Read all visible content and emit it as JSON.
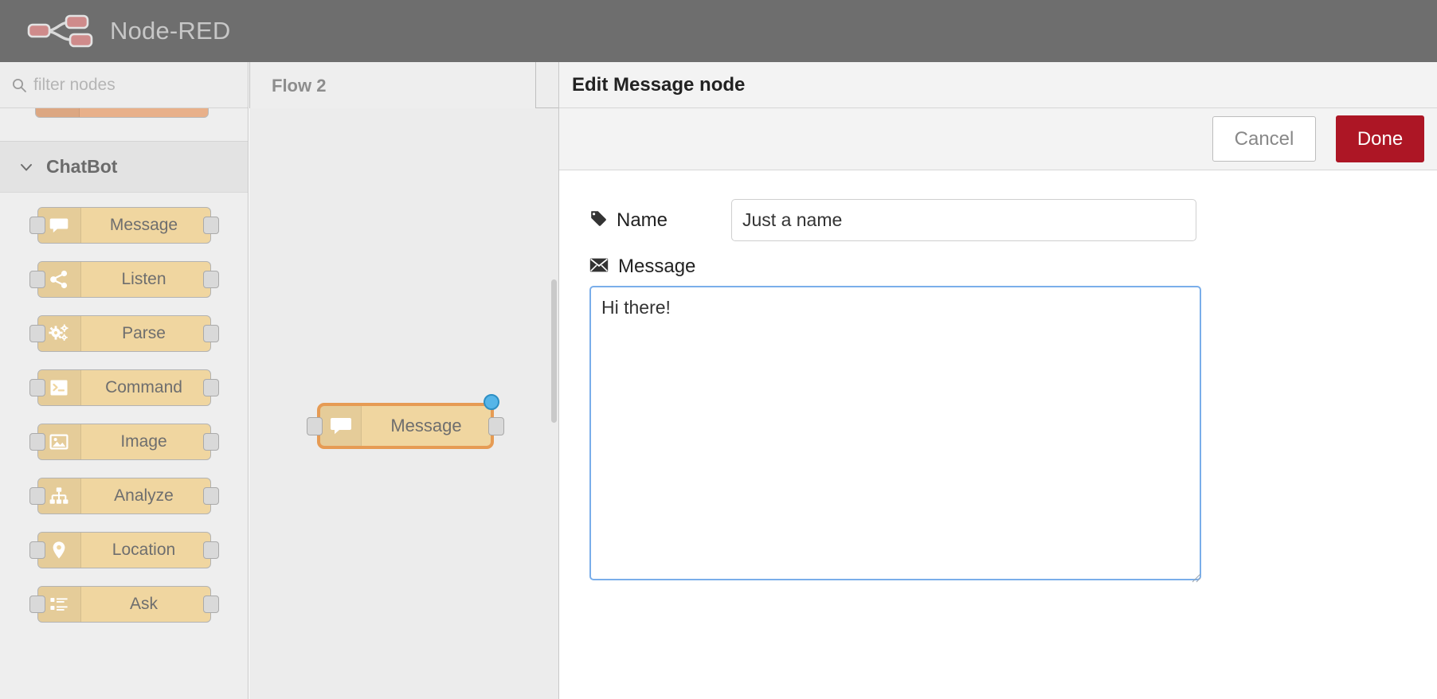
{
  "header": {
    "title": "Node-RED",
    "logo_icon": "node-red-logo-icon"
  },
  "palette": {
    "search": {
      "placeholder": "filter nodes",
      "value": "",
      "icon": "search-icon"
    },
    "category": {
      "label": "ChatBot",
      "chevron_icon": "chevron-down-icon",
      "expanded": true
    },
    "nodes": [
      {
        "label": "Message",
        "icon": "comment-icon"
      },
      {
        "label": "Listen",
        "icon": "share-nodes-icon"
      },
      {
        "label": "Parse",
        "icon": "cogs-icon"
      },
      {
        "label": "Command",
        "icon": "terminal-icon"
      },
      {
        "label": "Image",
        "icon": "image-icon"
      },
      {
        "label": "Analyze",
        "icon": "sitemap-icon"
      },
      {
        "label": "Location",
        "icon": "map-pin-icon"
      },
      {
        "label": "Ask",
        "icon": "list-icon"
      }
    ]
  },
  "workspace": {
    "tab": {
      "label": "Flow 2",
      "active": true
    },
    "node": {
      "label": "Message",
      "icon": "comment-icon",
      "selected": true,
      "changed_badge": true
    }
  },
  "editor": {
    "title": "Edit Message node",
    "buttons": {
      "cancel_label": "Cancel",
      "done_label": "Done"
    },
    "fields": {
      "name": {
        "label": "Name",
        "icon": "tag-icon",
        "value": "Just a name",
        "placeholder": "Name"
      },
      "message": {
        "label": "Message",
        "icon": "envelope-icon",
        "value": "Hi there!",
        "placeholder": "",
        "focused": true
      }
    }
  },
  "colors": {
    "header_bg": "#6e6e6e",
    "node_fill": "#f0d6a0",
    "node_selected_border": "#e69b54",
    "done_button": "#ad1625",
    "changed_badge": "#56b5e8",
    "focus_border": "#7aaeea"
  }
}
